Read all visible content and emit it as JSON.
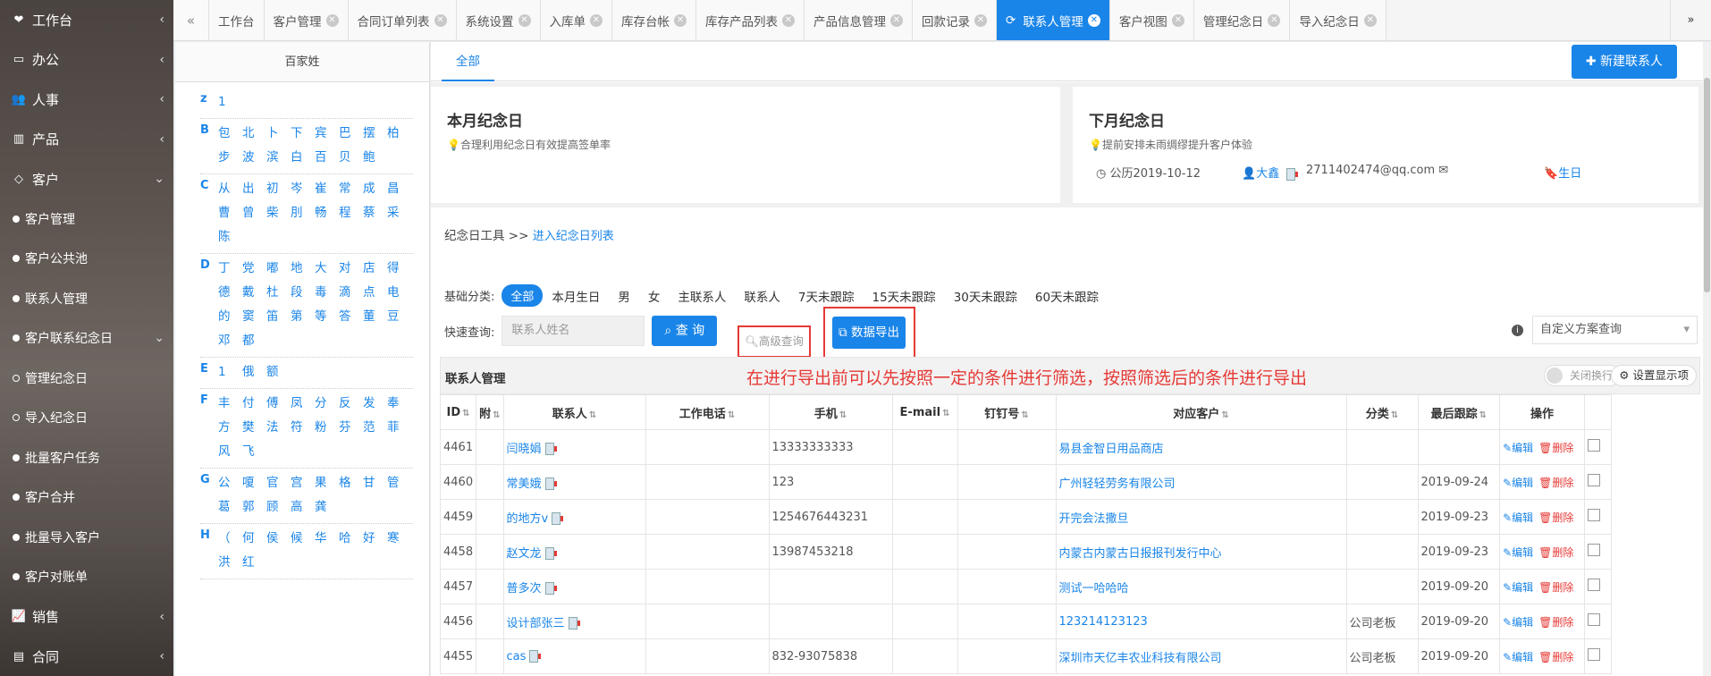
{
  "sidebar": {
    "items": [
      {
        "label": "工作台",
        "icon": "heart-icon",
        "type": "top",
        "chev": "‹"
      },
      {
        "label": "办公",
        "icon": "laptop-icon",
        "type": "top",
        "chev": "‹"
      },
      {
        "label": "人事",
        "icon": "users-icon",
        "type": "top",
        "chev": "‹"
      },
      {
        "label": "产品",
        "icon": "barcode-icon",
        "type": "top",
        "chev": "‹"
      },
      {
        "label": "客户",
        "icon": "diamond-icon",
        "type": "top",
        "chev": "⌄"
      },
      {
        "label": "客户管理",
        "type": "sub"
      },
      {
        "label": "客户公共池",
        "type": "sub"
      },
      {
        "label": "联系人管理",
        "type": "sub"
      },
      {
        "label": "客户联系纪念日",
        "type": "sub",
        "chev": "⌄"
      },
      {
        "label": "管理纪念日",
        "type": "subsub"
      },
      {
        "label": "导入纪念日",
        "type": "subsub"
      },
      {
        "label": "批量客户任务",
        "type": "sub"
      },
      {
        "label": "客户合并",
        "type": "sub"
      },
      {
        "label": "批量导入客户",
        "type": "sub"
      },
      {
        "label": "客户对账单",
        "type": "sub"
      },
      {
        "label": "销售",
        "icon": "line-chart-icon",
        "type": "top",
        "chev": "‹"
      },
      {
        "label": "合同",
        "icon": "contract-icon",
        "type": "top",
        "chev": "‹"
      }
    ]
  },
  "tabs": [
    {
      "label": "工作台",
      "closable": false
    },
    {
      "label": "客户管理",
      "closable": true
    },
    {
      "label": "合同订单列表",
      "closable": true
    },
    {
      "label": "系统设置",
      "closable": true
    },
    {
      "label": "入库单",
      "closable": true
    },
    {
      "label": "库存台帐",
      "closable": true
    },
    {
      "label": "库存产品列表",
      "closable": true
    },
    {
      "label": "产品信息管理",
      "closable": true
    },
    {
      "label": "回款记录",
      "closable": true
    },
    {
      "label": "联系人管理",
      "closable": true,
      "active": true
    },
    {
      "label": "客户视图",
      "closable": true
    },
    {
      "label": "管理纪念日",
      "closable": true
    },
    {
      "label": "导入纪念日",
      "closable": true
    }
  ],
  "alphabet": {
    "title": "百家姓",
    "groups": [
      {
        "letter": "z",
        "chars": [
          "1"
        ]
      },
      {
        "letter": "B",
        "chars": [
          "包",
          "北",
          "卜",
          "下",
          "宾",
          "巴",
          "摆",
          "柏",
          "步",
          "波",
          "滨",
          "白",
          "百",
          "贝",
          "鲍"
        ]
      },
      {
        "letter": "C",
        "chars": [
          "从",
          "出",
          "初",
          "岑",
          "崔",
          "常",
          "成",
          "昌",
          "曹",
          "曾",
          "柴",
          "刖",
          "畅",
          "程",
          "蔡",
          "采",
          "陈"
        ]
      },
      {
        "letter": "D",
        "chars": [
          "丁",
          "党",
          "嘟",
          "地",
          "大",
          "对",
          "店",
          "得",
          "德",
          "戴",
          "杜",
          "段",
          "毒",
          "滴",
          "点",
          "电",
          "的",
          "窦",
          "笛",
          "第",
          "等",
          "答",
          "董",
          "豆",
          "邓",
          "都"
        ]
      },
      {
        "letter": "E",
        "chars": [
          "1",
          "俄",
          "额"
        ]
      },
      {
        "letter": "F",
        "chars": [
          "丰",
          "付",
          "傅",
          "凤",
          "分",
          "反",
          "发",
          "奉",
          "方",
          "樊",
          "法",
          "符",
          "粉",
          "芬",
          "范",
          "菲",
          "风",
          "飞"
        ]
      },
      {
        "letter": "G",
        "chars": [
          "公",
          "嗄",
          "官",
          "宫",
          "果",
          "格",
          "甘",
          "管",
          "葛",
          "郭",
          "顾",
          "高",
          "龚"
        ]
      },
      {
        "letter": "H",
        "chars": [
          "（",
          "何",
          "侯",
          "候",
          "华",
          "哈",
          "好",
          "寒",
          "洪",
          "红"
        ]
      }
    ]
  },
  "main": {
    "subtab": "全部",
    "new_button": "新建联系人",
    "card1": {
      "title": "本月纪念日",
      "tip": "合理利用纪念日有效提高签单率"
    },
    "card2": {
      "title": "下月纪念日",
      "tip": "提前安排未雨绸缪提升客户体验",
      "date": "公历2019-10-12",
      "person": "大鑫",
      "email": "2711402474@qq.com",
      "kind": "生日"
    },
    "tools_label": "纪念日工具 >>",
    "tools_link": "进入纪念日列表",
    "filter_label": "基础分类:",
    "filters": [
      "全部",
      "本月生日",
      "男",
      "女",
      "主联系人",
      "联系人",
      "7天未跟踪",
      "15天未跟踪",
      "30天未跟踪",
      "60天未跟踪"
    ],
    "quick_label": "快速查询:",
    "quick_placeholder": "联系人姓名",
    "query_button": "查 询",
    "advanced_button": "高级查询",
    "export_button": "数据导出",
    "scheme_placeholder": "自定义方案查询",
    "grid_title": "联系人管理",
    "annotation": "在进行导出前可以先按照一定的条件进行筛选，按照筛选后的条件进行导出",
    "wrap_toggle": "关闭换行",
    "display_settings": "设置显示项"
  },
  "table": {
    "headers": [
      "ID",
      "附",
      "联系人",
      "工作电话",
      "手机",
      "E-mail",
      "钉钉号",
      "对应客户",
      "分类",
      "最后跟踪",
      "操作"
    ],
    "edit_label": "编辑",
    "delete_label": "删除",
    "rows": [
      [
        "4461",
        "",
        "闫晓娟",
        "",
        "13333333333",
        "",
        "",
        "易县金智日用品商店",
        "",
        ""
      ],
      [
        "4460",
        "",
        "常美娥",
        "",
        "123",
        "",
        "",
        "广州轻轻劳务有限公司",
        "",
        "2019-09-24"
      ],
      [
        "4459",
        "",
        "的地方v",
        "",
        "1254676443231",
        "",
        "",
        "开完会法撒旦",
        "",
        "2019-09-23"
      ],
      [
        "4458",
        "",
        "赵文龙",
        "",
        "13987453218",
        "",
        "",
        "内蒙古内蒙古日报报刊发行中心",
        "",
        "2019-09-23"
      ],
      [
        "4457",
        "",
        "普多次",
        "",
        "",
        "",
        "",
        "测试一哈哈哈",
        "",
        "2019-09-20"
      ],
      [
        "4456",
        "",
        "设计部张三",
        "",
        "",
        "",
        "",
        "123214123123",
        "公司老板",
        "2019-09-20"
      ],
      [
        "4455",
        "",
        "cas",
        "",
        "832-93075838",
        "",
        "",
        "深圳市天亿丰农业科技有限公司",
        "公司老板",
        "2019-09-20"
      ]
    ]
  }
}
